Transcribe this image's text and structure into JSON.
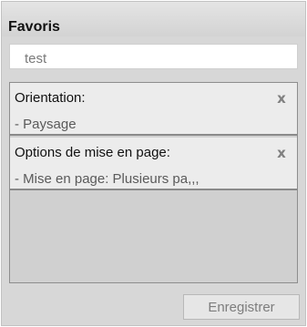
{
  "panel": {
    "title": "Favoris"
  },
  "favorite_name": {
    "value": "test"
  },
  "settings": [
    {
      "label": "Orientation:",
      "value": "- Paysage",
      "remove_icon": "x"
    },
    {
      "label": "Options de mise en page:",
      "value": "- Mise en page: Plusieurs pa,,,",
      "remove_icon": "x"
    }
  ],
  "actions": {
    "save_label": "Enregistrer"
  },
  "icons": {
    "remove": "close-icon"
  },
  "colors": {
    "background": "#d7d7d7",
    "list_background": "#d0d0d0",
    "item_background": "#ececec",
    "separator": "#8a8a8a"
  }
}
